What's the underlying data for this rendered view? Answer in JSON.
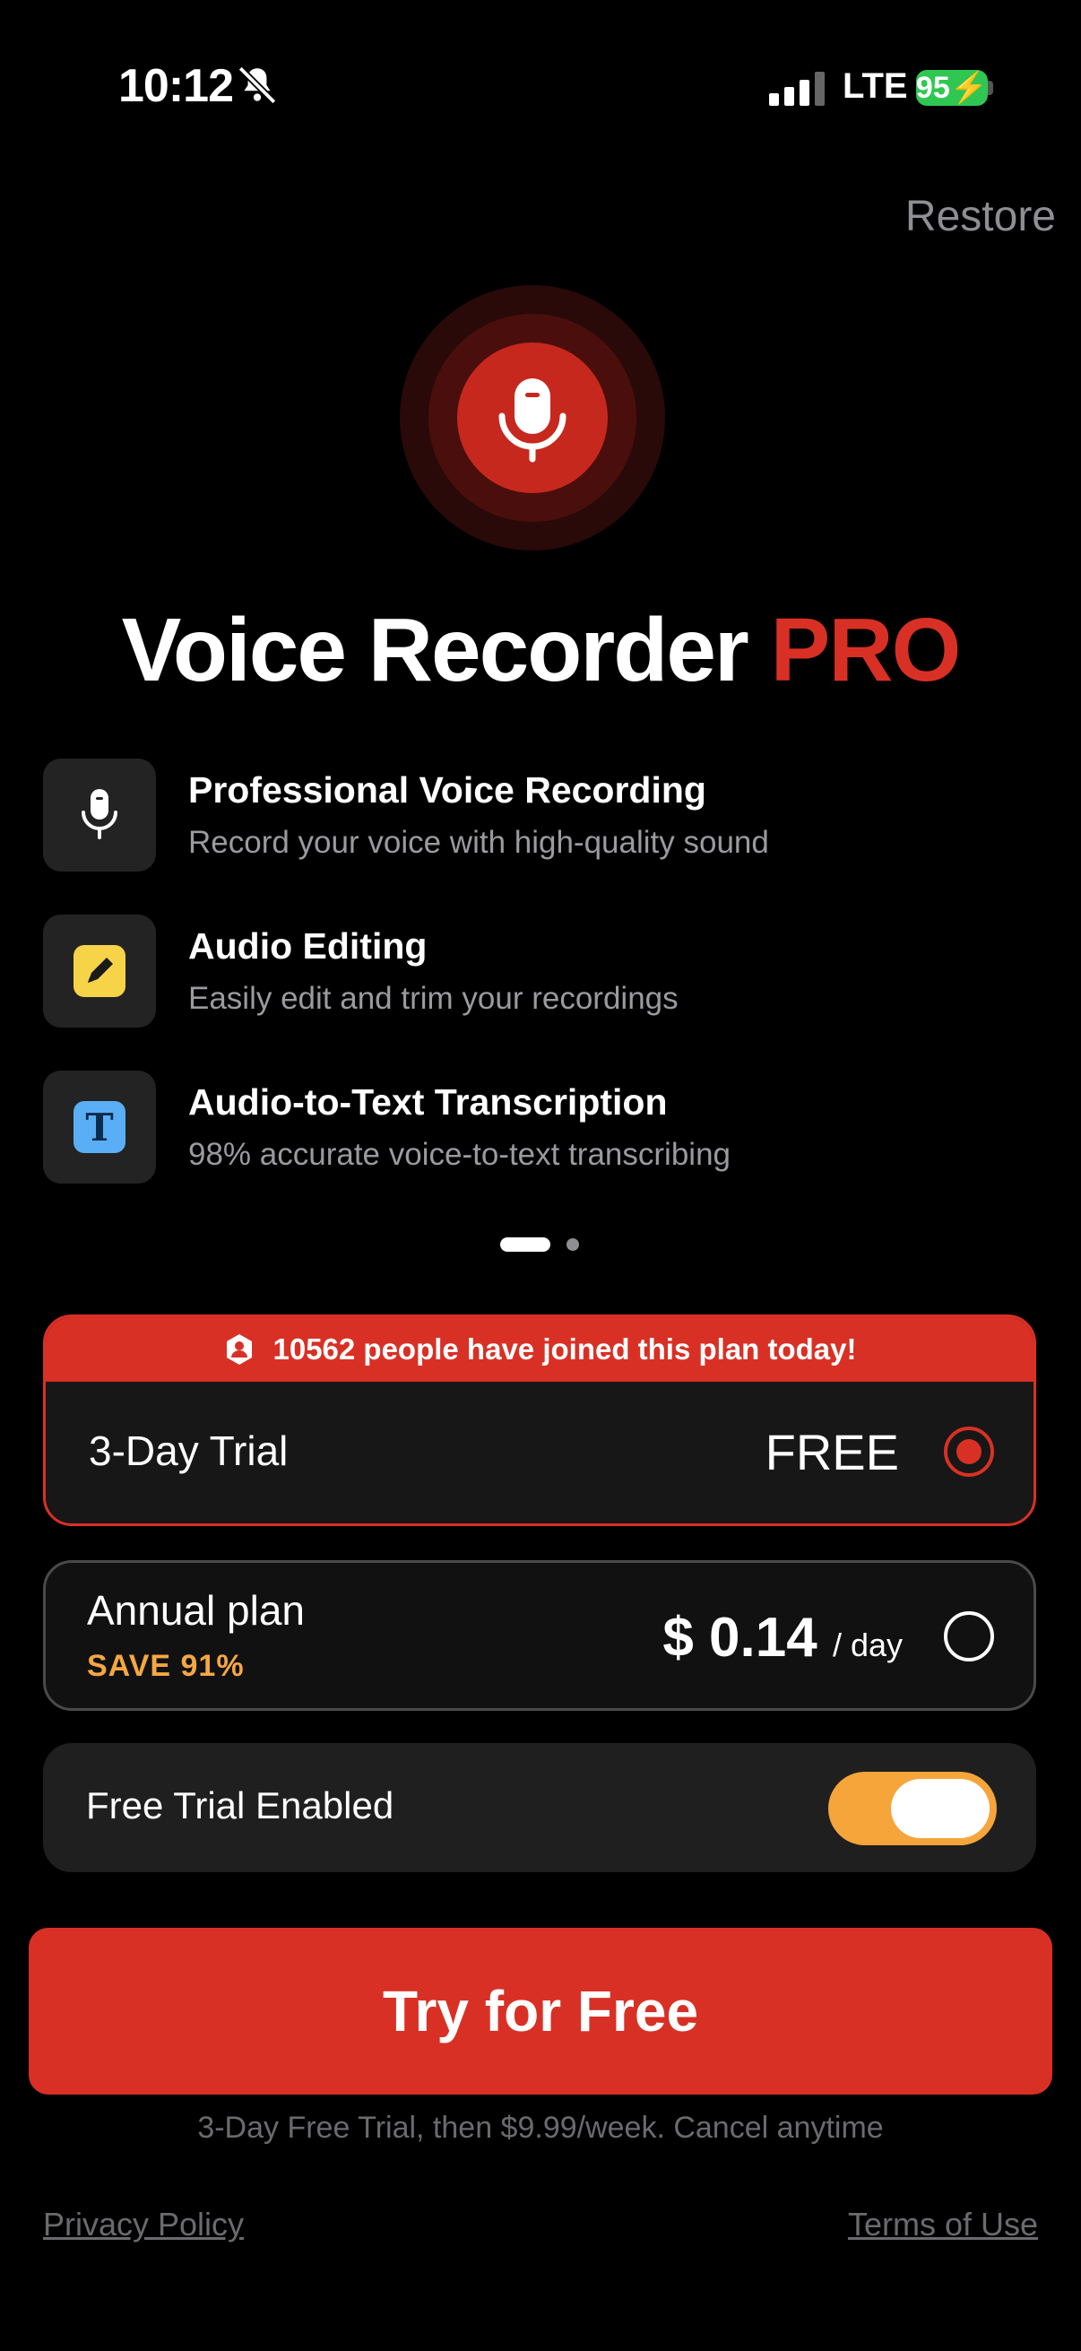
{
  "status_bar": {
    "time": "10:12",
    "network": "LTE",
    "battery": "95"
  },
  "header": {
    "restore_label": "Restore"
  },
  "hero": {
    "title_main": "Voice Recorder",
    "title_accent": "PRO"
  },
  "features": [
    {
      "icon": "microphone-icon",
      "title": "Professional Voice Recording",
      "description": "Record your voice with high-quality sound"
    },
    {
      "icon": "pencil-edit-icon",
      "title": "Audio Editing",
      "description": "Easily edit and trim your recordings"
    },
    {
      "icon": "text-t-icon",
      "title": "Audio-to-Text Transcription",
      "description": "98% accurate voice-to-text transcribing"
    }
  ],
  "carousel": {
    "page": 1,
    "total": 2
  },
  "plans": {
    "banner": "10562 people have joined this plan today!",
    "trial": {
      "label": "3-Day Trial",
      "price": "FREE",
      "selected": true
    },
    "annual": {
      "label": "Annual plan",
      "save": "SAVE 91%",
      "price": "$ 0.14",
      "period": "/ day",
      "selected": false
    }
  },
  "free_trial_toggle": {
    "label": "Free Trial Enabled",
    "enabled": true
  },
  "cta": {
    "label": "Try for Free"
  },
  "footer": {
    "terms_note": "3-Day Free Trial, then $9.99/week. Cancel anytime",
    "privacy": "Privacy Policy",
    "terms": "Terms of Use"
  },
  "colors": {
    "accent": "#d93025",
    "toggle_on": "#f5a53a",
    "save": "#f5a742"
  }
}
